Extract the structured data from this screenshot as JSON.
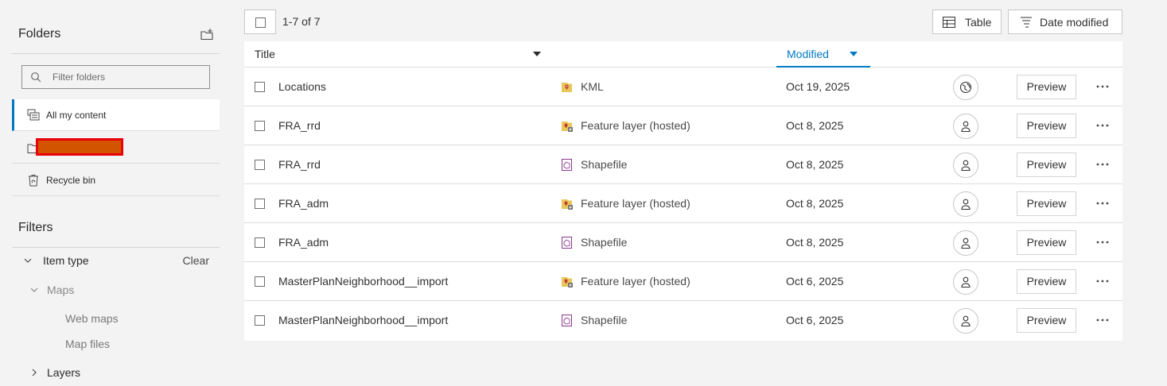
{
  "sidebar": {
    "folders_title": "Folders",
    "filter_placeholder": "Filter folders",
    "folders": [
      {
        "label": "All my content",
        "icon": "all-content-icon",
        "active": true
      },
      {
        "label": "",
        "icon": "user-folder-icon",
        "redacted": true
      },
      {
        "label": "Recycle bin",
        "icon": "recycle-bin-icon"
      }
    ],
    "filters_title": "Filters",
    "item_type_label": "Item type",
    "clear_label": "Clear",
    "maps_label": "Maps",
    "web_maps_label": "Web maps",
    "map_files_label": "Map files",
    "layers_label": "Layers"
  },
  "toolbar": {
    "count": "1-7 of 7",
    "table_label": "Table",
    "sort_label": "Date modified"
  },
  "table": {
    "col_title": "Title",
    "col_modified": "Modified",
    "preview_label": "Preview",
    "rows": [
      {
        "title": "Locations",
        "type": "KML",
        "type_icon": "kml-icon",
        "date": "Oct 19, 2025",
        "sharing": "public"
      },
      {
        "title": "FRA_rrd",
        "type": "Feature layer (hosted)",
        "type_icon": "feature-layer-icon",
        "date": "Oct 8, 2025",
        "sharing": "owner"
      },
      {
        "title": "FRA_rrd",
        "type": "Shapefile",
        "type_icon": "shapefile-icon",
        "date": "Oct 8, 2025",
        "sharing": "owner"
      },
      {
        "title": "FRA_adm",
        "type": "Feature layer (hosted)",
        "type_icon": "feature-layer-icon",
        "date": "Oct 8, 2025",
        "sharing": "owner"
      },
      {
        "title": "FRA_adm",
        "type": "Shapefile",
        "type_icon": "shapefile-icon",
        "date": "Oct 8, 2025",
        "sharing": "owner"
      },
      {
        "title": "MasterPlanNeighborhood__import",
        "type": "Feature layer (hosted)",
        "type_icon": "feature-layer-icon",
        "date": "Oct 6, 2025",
        "sharing": "owner"
      },
      {
        "title": "MasterPlanNeighborhood__import",
        "type": "Shapefile",
        "type_icon": "shapefile-icon",
        "date": "Oct 6, 2025",
        "sharing": "owner"
      }
    ]
  },
  "colors": {
    "accent": "#007ac2",
    "redaction_border": "#e8000b",
    "redaction_fill": "#d35400",
    "layer_icon": "#e8c65a",
    "shapefile_icon": "#8a3a8f"
  }
}
